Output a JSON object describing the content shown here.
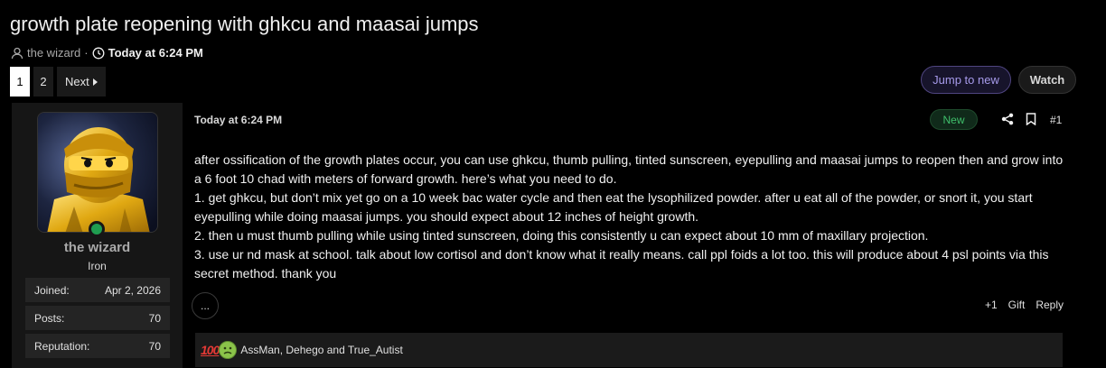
{
  "thread": {
    "title": "growth plate reopening with ghkcu and maasai jumps",
    "author": "the wizard",
    "separator": "·",
    "time": "Today at 6:24 PM"
  },
  "pagination": {
    "pages": [
      "1",
      "2"
    ],
    "current": "1",
    "next_label": "Next"
  },
  "buttons": {
    "jump_to_new": "Jump to new",
    "watch": "Watch"
  },
  "user": {
    "name": "the wizard",
    "rank": "Iron",
    "stats": [
      {
        "label": "Joined:",
        "value": "Apr 2, 2026"
      },
      {
        "label": "Posts:",
        "value": "70"
      },
      {
        "label": "Reputation:",
        "value": "70"
      }
    ]
  },
  "post": {
    "date": "Today at 6:24 PM",
    "badge": "New",
    "number": "#1",
    "lines": [
      "after ossification of the growth plates occur, you can use ghkcu, thumb pulling, tinted sunscreen, eyepulling and maasai jumps to reopen then and grow into a 6 foot 10 chad with meters of forward growth. here’s what you need to do.",
      "1. get ghkcu, but don’t mix yet go on a 10 week bac water cycle and then eat the lysophilized powder. after u eat all of the powder, or snort it, you start eyepulling while doing maasai jumps. you should expect about 12 inches of height growth.",
      "2. then u must thumb pulling while using tinted sunscreen, doing this consistently u can expect about 10 mm of maxillary projection.",
      "3. use ur nd mask at school. talk about low cortisol and don’t know what it really means. call ppl foids a lot too. this will produce about 4 psl points via this secret method. thank you"
    ],
    "more_label": "...",
    "actions": [
      "+1",
      "Gift",
      "Reply"
    ],
    "reaction_100": "100",
    "reactions_text": "AssMan, Dehego and True_Autist"
  },
  "colors": {
    "background": "#000000",
    "accent_purple": "#a69aea",
    "online_green": "#1f9d50",
    "new_badge_green": "#3fbf6b"
  },
  "icons": [
    "user-icon",
    "clock-icon",
    "share-icon",
    "bookmark-icon",
    "caret-right-icon",
    "hundred-points-icon",
    "sick-face-icon"
  ]
}
